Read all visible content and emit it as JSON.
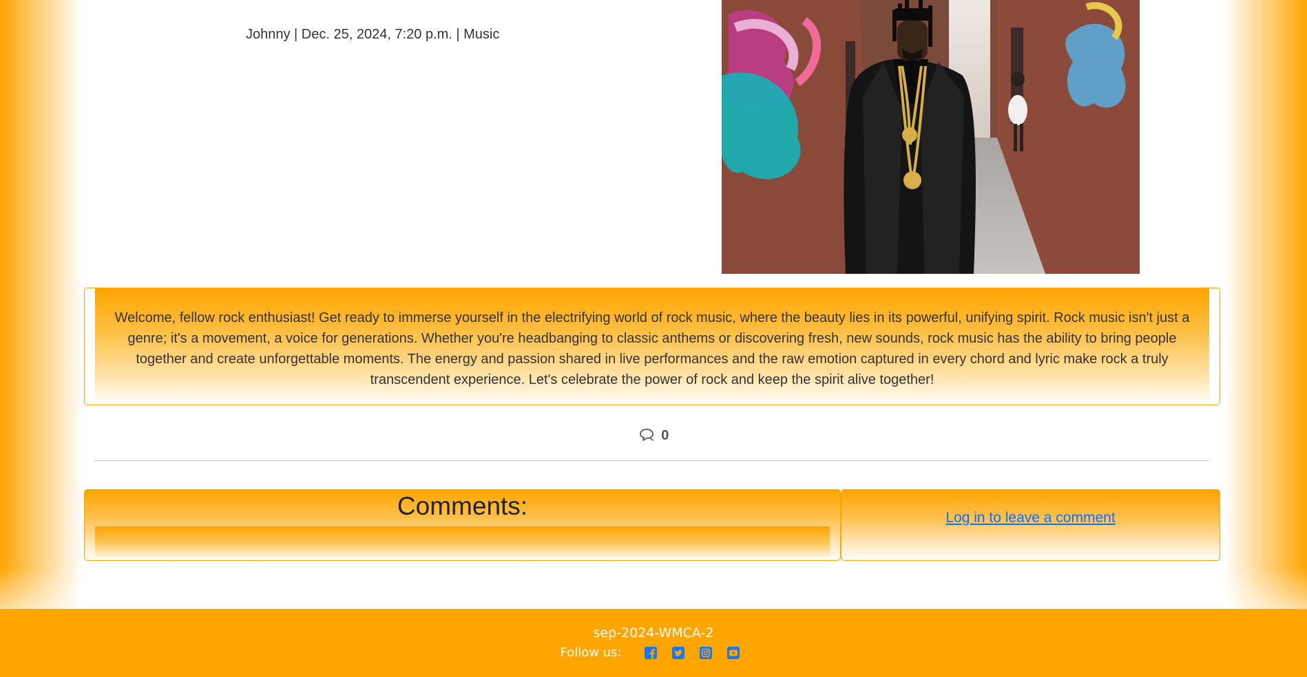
{
  "post": {
    "meta": "Johnny | Dec. 25, 2024, 7:20 p.m. | Music",
    "excerpt": "Welcome, fellow rock enthusiast! Get ready to immerse yourself in the electrifying world of rock music, where the beauty lies in its powerful, unifying spirit. Rock music isn't just a genre; it's a movement, a voice for generations. Whether you're headbanging to classic anthems or discovering fresh, new sounds, rock music has the ability to bring people together and create unforgettable moments. The energy and passion shared in live performances and the raw emotion captured in every chord and lyric make rock a truly transcendent experience. Let's celebrate the power of rock and keep the spirit alive together!",
    "comment_count": "0",
    "image_icon": "photo-man-leather-jacket"
  },
  "comments": {
    "title": "Comments:",
    "login_link": "Log in to leave a comment"
  },
  "footer": {
    "brand": "sep-2024-WMCA-2",
    "follow_label": "Follow us:",
    "social_icons": [
      "facebook-icon",
      "twitter-icon",
      "instagram-icon",
      "youtube-icon"
    ]
  },
  "colors": {
    "accent": "#ffa500",
    "link": "#0d6efd",
    "social_icon": "#1877f2"
  }
}
